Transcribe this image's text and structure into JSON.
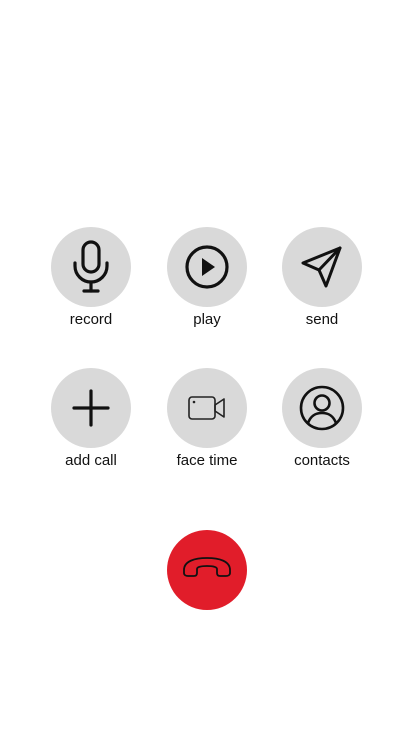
{
  "actions": {
    "record": {
      "label": "record",
      "icon": "microphone-icon"
    },
    "play": {
      "label": "play",
      "icon": "play-icon"
    },
    "send": {
      "label": "send",
      "icon": "send-icon"
    },
    "add_call": {
      "label": "add call",
      "icon": "plus-icon"
    },
    "face_time": {
      "label": "face time",
      "icon": "video-camera-icon"
    },
    "contacts": {
      "label": "contacts",
      "icon": "person-circle-icon"
    }
  },
  "end_call": {
    "icon": "phone-hangup-icon"
  },
  "colors": {
    "button_background": "#d9d9d9",
    "end_call_background": "#e11d2a",
    "icon_stroke": "#111111",
    "end_call_icon_stroke": "#111111"
  }
}
